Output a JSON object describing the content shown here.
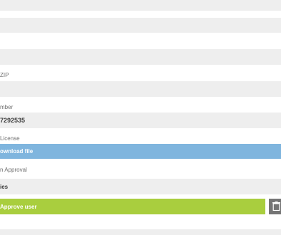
{
  "fields": {
    "zip_label": "ZIP",
    "phone_label": "mber",
    "phone_value": "7292535",
    "license_label": "License",
    "approval_label": "n Approval"
  },
  "actions": {
    "download_label": "ownload file",
    "approve_label": "Approve user"
  },
  "section": {
    "title": "ies"
  },
  "colors": {
    "download_bg": "#7fb5de",
    "approve_bg": "#a9ce3e",
    "delete_bg": "#757575",
    "field_bg": "#eeeeee"
  },
  "icons": {
    "delete": "trash-icon"
  }
}
